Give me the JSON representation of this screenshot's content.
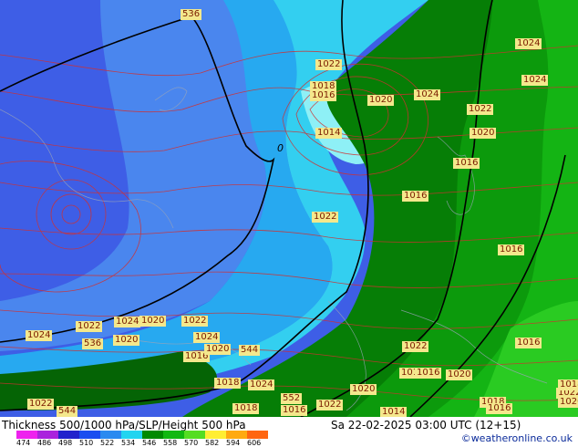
{
  "map": {
    "thickness_labels": [
      "536",
      "536",
      "544",
      "544",
      "552"
    ],
    "pressure_labels": [
      "1022",
      "1018",
      "1016",
      "1020",
      "1024",
      "1022",
      "1024",
      "1020",
      "1014",
      "1016",
      "1016",
      "1022",
      "1016",
      "1024",
      "1022",
      "1024",
      "1024",
      "1020",
      "1022",
      "1024",
      "1020",
      "1016",
      "1020",
      "1018",
      "1024",
      "1018",
      "1020",
      "1022",
      "1016",
      "1018",
      "1016",
      "1020",
      "1022",
      "1014",
      "1018",
      "1022",
      "1018",
      "1020",
      "1016",
      "1022",
      "1016"
    ],
    "zero_label": "0"
  },
  "footer": {
    "title": "Thickness 500/1000 hPa/SLP/Height 500 hPa",
    "datetime": "Sa 22-02-2025 03:00 UTC (12+15)",
    "credit": "©weatheronline.co.uk",
    "scale_values": [
      "474",
      "486",
      "498",
      "510",
      "522",
      "534",
      "546",
      "558",
      "570",
      "582",
      "594",
      "606"
    ],
    "scale_colors": [
      "#ee22ee",
      "#aa22dd",
      "#2222cc",
      "#1a4ef0",
      "#2a8af0",
      "#22d4f0",
      "#008a00",
      "#11b811",
      "#55dd22",
      "#ffee33",
      "#ffaa11",
      "#ff6611"
    ]
  }
}
